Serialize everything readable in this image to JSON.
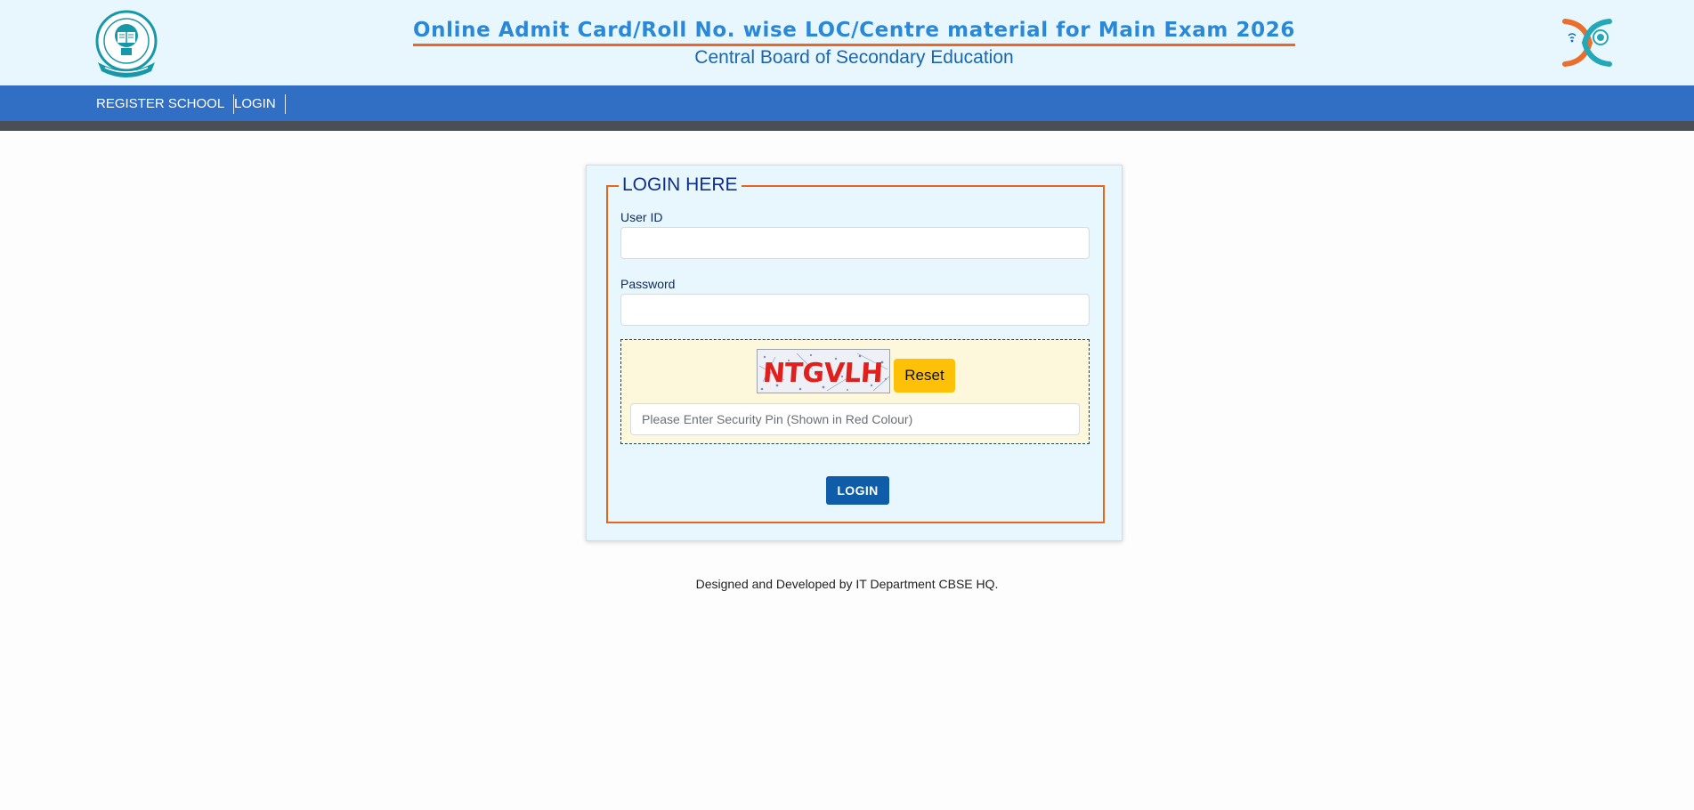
{
  "header": {
    "title": "Online Admit Card/Roll No. wise LOC/Centre material for Main Exam 2026",
    "subtitle": "Central Board of Secondary Education",
    "left_logo_icon": "cbse-emblem-icon",
    "right_logo_icon": "digital-cbse-logo-icon"
  },
  "nav": {
    "items": [
      {
        "label": "REGISTER SCHOOL"
      },
      {
        "label": "LOGIN"
      }
    ]
  },
  "login": {
    "legend": "LOGIN HERE",
    "user_id_label": "User ID",
    "user_id_value": "",
    "password_label": "Password",
    "password_value": "",
    "captcha_text": "NTGVLH",
    "reset_label": "Reset",
    "pin_placeholder": "Please Enter Security Pin (Shown in Red Colour)",
    "pin_value": "",
    "submit_label": "LOGIN"
  },
  "footer": {
    "text": "Designed and Developed by IT Department CBSE HQ."
  },
  "colors": {
    "header_bg": "#e8f6fd",
    "nav_bg": "#306fc4",
    "nav_strip": "#4a4f55",
    "title_blue": "#2a88d8",
    "title_underline": "#e8682a",
    "fieldset_border": "#e8641b",
    "captcha_bg": "#fdf8dc",
    "reset_button": "#fec107",
    "login_button": "#0f5ca8",
    "captcha_text": "#e0201d"
  }
}
